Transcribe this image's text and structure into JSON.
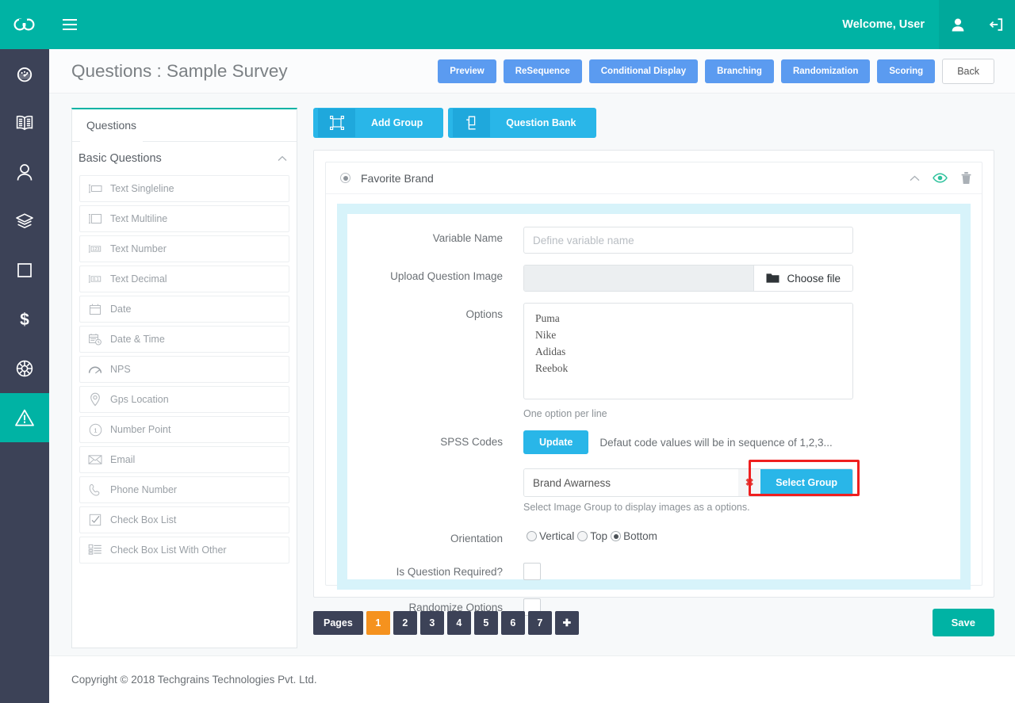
{
  "topbar": {
    "logo_icon": "infinity-logo-icon",
    "menu_icon": "hamburger-menu-icon",
    "welcome_text": "Welcome, User",
    "user_icon": "user-icon",
    "logout_icon": "logout-icon",
    "background_color": "#00b3a4"
  },
  "rail": {
    "items": [
      {
        "name": "dashboard",
        "icon": "speedometer-icon",
        "active": false
      },
      {
        "name": "library",
        "icon": "book-icon",
        "active": false
      },
      {
        "name": "users",
        "icon": "user-icon",
        "active": false
      },
      {
        "name": "layers",
        "icon": "layers-icon",
        "active": false
      },
      {
        "name": "panel",
        "icon": "square-icon",
        "active": false
      },
      {
        "name": "billing",
        "icon": "dollar-icon",
        "active": false
      },
      {
        "name": "global",
        "icon": "globe-icon",
        "active": false
      },
      {
        "name": "surveys",
        "icon": "warning-triangle-icon",
        "active": true
      }
    ],
    "active_color": "#00b3a4",
    "background_color": "#3c4257"
  },
  "header": {
    "title": "Questions : Sample Survey",
    "actions": [
      {
        "label": "Preview",
        "style": "blue"
      },
      {
        "label": "ReSequence",
        "style": "blue"
      },
      {
        "label": "Conditional Display",
        "style": "blue"
      },
      {
        "label": "Branching",
        "style": "blue"
      },
      {
        "label": "Randomization",
        "style": "blue"
      },
      {
        "label": "Scoring",
        "style": "blue"
      },
      {
        "label": "Back",
        "style": "white"
      }
    ],
    "blue_color": "#5b9bf0"
  },
  "questions_panel": {
    "tab_label": "Questions",
    "group_label": "Basic Questions",
    "collapse_icon": "chevron-up-icon",
    "items": [
      {
        "label": "Text Singleline",
        "icon": "text-singleline-icon"
      },
      {
        "label": "Text Multiline",
        "icon": "text-multiline-icon"
      },
      {
        "label": "Text Number",
        "icon": "text-number-icon"
      },
      {
        "label": "Text Decimal",
        "icon": "text-decimal-icon"
      },
      {
        "label": "Date",
        "icon": "calendar-icon"
      },
      {
        "label": "Date & Time",
        "icon": "calendar-clock-icon"
      },
      {
        "label": "NPS",
        "icon": "gauge-icon"
      },
      {
        "label": "Gps Location",
        "icon": "map-pin-icon"
      },
      {
        "label": "Number Point",
        "icon": "number-point-icon"
      },
      {
        "label": "Email",
        "icon": "envelope-icon"
      },
      {
        "label": "Phone Number",
        "icon": "phone-icon"
      },
      {
        "label": "Check Box List",
        "icon": "checkbox-icon"
      },
      {
        "label": "Check Box List With Other",
        "icon": "checkbox-list-other-icon"
      }
    ]
  },
  "toolbar": {
    "add_group_label": "Add Group",
    "add_group_icon": "group-frame-icon",
    "question_bank_label": "Question Bank",
    "question_bank_icon": "copy-icon",
    "color": "#29b6e8"
  },
  "question": {
    "title": "Favorite Brand",
    "radio_icon": "radio-selected-icon",
    "collapse_icon": "chevron-up-icon",
    "preview_icon": "eye-icon",
    "delete_icon": "trash-icon",
    "fields": {
      "variable_name_label": "Variable Name",
      "variable_name_value": "",
      "variable_name_placeholder": "Define variable name",
      "upload_image_label": "Upload Question Image",
      "choose_file_label": "Choose file",
      "choose_file_icon": "folder-icon",
      "options_label": "Options",
      "options_value": "Puma\nNike\nAdidas\nReebok",
      "options_hint": "One option per line",
      "spss_label": "SPSS Codes",
      "spss_update_label": "Update",
      "spss_note": "Defaut code values will be in sequence of 1,2,3...",
      "group_value": "Brand Awarness",
      "group_clear_icon": "close-x-icon",
      "select_group_label": "Select Group",
      "group_hint": "Select Image Group to display images as a options.",
      "orientation_label": "Orientation",
      "orientation_options": [
        "Vertical",
        "Top",
        "Bottom"
      ],
      "orientation_selected": "Bottom",
      "required_label": "Is Question Required?",
      "required_checked": false,
      "randomize_label": "Randomize Options",
      "randomize_checked": false
    },
    "highlight_color": "#ef1f1f"
  },
  "pager": {
    "label": "Pages",
    "pages": [
      "1",
      "2",
      "3",
      "4",
      "5",
      "6",
      "7"
    ],
    "active_page": "1",
    "add_label": "✚",
    "active_color": "#f5921e"
  },
  "save": {
    "label": "Save",
    "color": "#00b3a4"
  },
  "footer": {
    "text": "Copyright © 2018 Techgrains Technologies Pvt. Ltd."
  }
}
